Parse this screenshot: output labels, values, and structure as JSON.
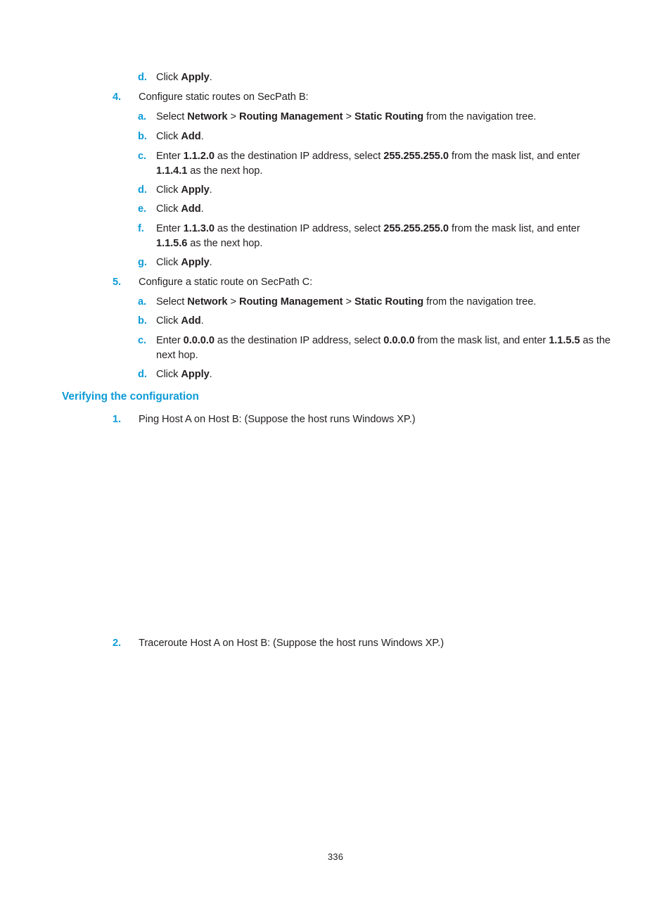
{
  "document": {
    "page_number": "336",
    "accent_color": "#0d9bd7",
    "text_color": "#231f20"
  },
  "blocks": {
    "step3d": {
      "marker": "d.",
      "prefix": "Click ",
      "bold": "Apply",
      "suffix": "."
    },
    "step4": {
      "marker": "4.",
      "text": "Configure static routes on SecPath B:"
    },
    "step4a": {
      "marker": "a.",
      "t1": "Select ",
      "b1": "Network",
      "t2": " > ",
      "b2": "Routing Management",
      "t3": " > ",
      "b3": "Static Routing",
      "t4": " from the navigation tree."
    },
    "step4b": {
      "marker": "b.",
      "prefix": "Click ",
      "bold": "Add",
      "suffix": "."
    },
    "step4c": {
      "marker": "c.",
      "t1": "Enter ",
      "b1": "1.1.2.0",
      "t2": " as the destination IP address, select ",
      "b2": "255.255.255.0",
      "t3": " from the mask list, and enter ",
      "b3": "1.1.4.1",
      "t4": " as the next hop."
    },
    "step4d": {
      "marker": "d.",
      "prefix": "Click ",
      "bold": "Apply",
      "suffix": "."
    },
    "step4e": {
      "marker": "e.",
      "prefix": "Click ",
      "bold": "Add",
      "suffix": "."
    },
    "step4f": {
      "marker": "f.",
      "t1": "Enter ",
      "b1": "1.1.3.0",
      "t2": " as the destination IP address, select ",
      "b2": "255.255.255.0",
      "t3": " from the mask list, and enter ",
      "b3": "1.1.5.6",
      "t4": " as the next hop."
    },
    "step4g": {
      "marker": "g.",
      "prefix": "Click ",
      "bold": "Apply",
      "suffix": "."
    },
    "step5": {
      "marker": "5.",
      "text": "Configure a static route on SecPath C:"
    },
    "step5a": {
      "marker": "a.",
      "t1": "Select ",
      "b1": "Network",
      "t2": " > ",
      "b2": "Routing Management",
      "t3": " > ",
      "b3": "Static Routing",
      "t4": " from the navigation tree."
    },
    "step5b": {
      "marker": "b.",
      "prefix": " Click ",
      "bold": "Add",
      "suffix": "."
    },
    "step5c": {
      "marker": "c.",
      "t1": "Enter ",
      "b1": "0.0.0.0",
      "t2": " as the destination IP address, select ",
      "b2": "0.0.0.0",
      "t3": " from the mask list, and enter ",
      "b3": "1.1.5.5",
      "t4": " as the next hop."
    },
    "step5d": {
      "marker": "d.",
      "prefix": "Click ",
      "bold": "Apply",
      "suffix": "."
    },
    "verify_heading": {
      "text": "Verifying the configuration"
    },
    "verify1": {
      "marker": "1.",
      "text": "Ping Host A on Host B: (Suppose the host runs Windows XP.)"
    },
    "verify2": {
      "marker": "2.",
      "text": "Traceroute Host A on Host B: (Suppose the host runs Windows XP.)"
    }
  }
}
